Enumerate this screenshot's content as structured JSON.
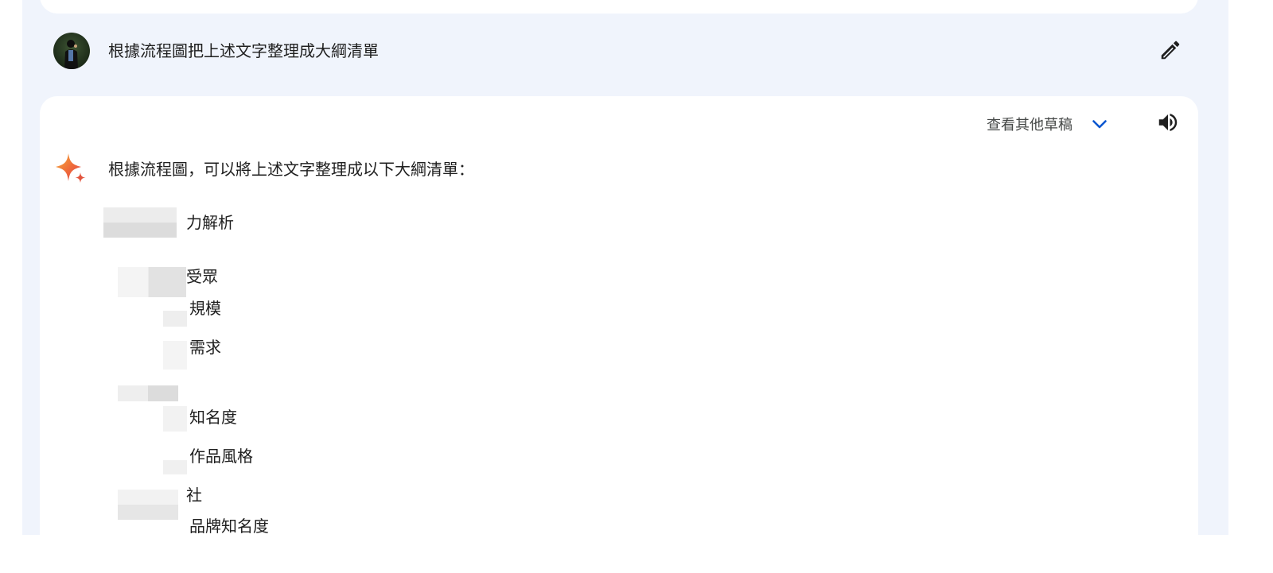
{
  "user_prompt": {
    "text": "根據流程圖把上述文字整理成大綱清單",
    "edit_icon": "pencil-icon"
  },
  "response": {
    "drafts_label": "查看其他草稿",
    "drafts_icon": "chevron-down-icon",
    "speaker_icon": "volume-icon",
    "intro": "根據流程圖，可以將上述文字整理成以下大綱清單：",
    "outline": [
      {
        "text": "力解析"
      },
      {
        "text": "受眾"
      },
      {
        "text": "規模"
      },
      {
        "text": "需求"
      },
      {
        "text": "知名度"
      },
      {
        "text": "作品風格"
      },
      {
        "text": "社"
      },
      {
        "text": "品牌知名度"
      }
    ]
  },
  "colors": {
    "outer_background": "#f0f4fc",
    "card_background": "#ffffff",
    "accent_blue": "#0b57d0",
    "text": "#1f1f1f",
    "muted_text": "#444746"
  }
}
